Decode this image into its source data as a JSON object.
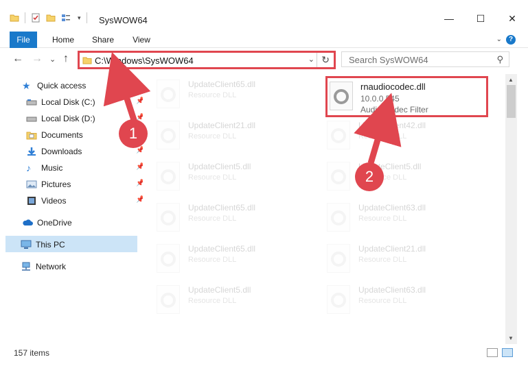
{
  "window": {
    "title": "SysWOW64",
    "minimize_glyph": "—",
    "maximize_glyph": "☐",
    "close_glyph": "✕"
  },
  "ribbon": {
    "tabs": [
      "File",
      "Home",
      "Share",
      "View"
    ],
    "expand_glyph": "⌄",
    "help_glyph": "?"
  },
  "nav": {
    "back_glyph": "←",
    "forward_glyph": "→",
    "recent_glyph": "⌄",
    "up_glyph": "↑"
  },
  "address": {
    "path": "C:\\Windows\\SysWOW64",
    "dropdown_glyph": "⌄",
    "refresh_glyph": "↻"
  },
  "search": {
    "placeholder": "Search SysWOW64",
    "icon_glyph": "⚲"
  },
  "sidebar": {
    "items": [
      {
        "label": "Quick access",
        "icon": "star-icon"
      },
      {
        "label": "Local Disk (C:)",
        "icon": "drive-icon",
        "pinned": true
      },
      {
        "label": "Local Disk (D:)",
        "icon": "drive-icon",
        "pinned": true
      },
      {
        "label": "Documents",
        "icon": "documents-icon",
        "pinned": true
      },
      {
        "label": "Downloads",
        "icon": "download-icon",
        "pinned": true
      },
      {
        "label": "Music",
        "icon": "music-icon",
        "pinned": true
      },
      {
        "label": "Pictures",
        "icon": "pictures-icon",
        "pinned": true
      },
      {
        "label": "Videos",
        "icon": "videos-icon",
        "pinned": true
      },
      {
        "label": "OneDrive",
        "icon": "cloud-icon"
      },
      {
        "label": "This PC",
        "icon": "computer-icon",
        "selected": true
      },
      {
        "label": "Network",
        "icon": "network-icon"
      }
    ]
  },
  "files": {
    "left_column": [
      {
        "name": "UpdateClient65.dll",
        "type": "Resource DLL"
      },
      {
        "name": "UpdateClient21.dll",
        "type": "Resource DLL"
      },
      {
        "name": "UpdateClient5.dll",
        "type": "Resource DLL"
      },
      {
        "name": "UpdateClient65.dll",
        "type": "Resource DLL"
      },
      {
        "name": "UpdateClient65.dll",
        "type": "Resource DLL"
      },
      {
        "name": "UpdateClient5.dll",
        "type": "Resource DLL"
      }
    ],
    "highlighted": {
      "name": "rnaudiocodec.dll",
      "version": "10.0.0.545",
      "description": "Audio Codec Filter"
    },
    "right_column": [
      {
        "name": "UpdateClient42.dll",
        "type": "Resource DLL"
      },
      {
        "name": "UpdateClient5.dll",
        "type": "Resource DLL"
      },
      {
        "name": "UpdateClient63.dll",
        "type": "Resource DLL"
      },
      {
        "name": "UpdateClient21.dll",
        "type": "Resource DLL"
      },
      {
        "name": "UpdateClient63.dll",
        "type": "Resource DLL"
      }
    ]
  },
  "annotations": {
    "callout_1": "1",
    "callout_2": "2",
    "color": "#e0464f"
  },
  "statusbar": {
    "item_count": "157 items"
  }
}
